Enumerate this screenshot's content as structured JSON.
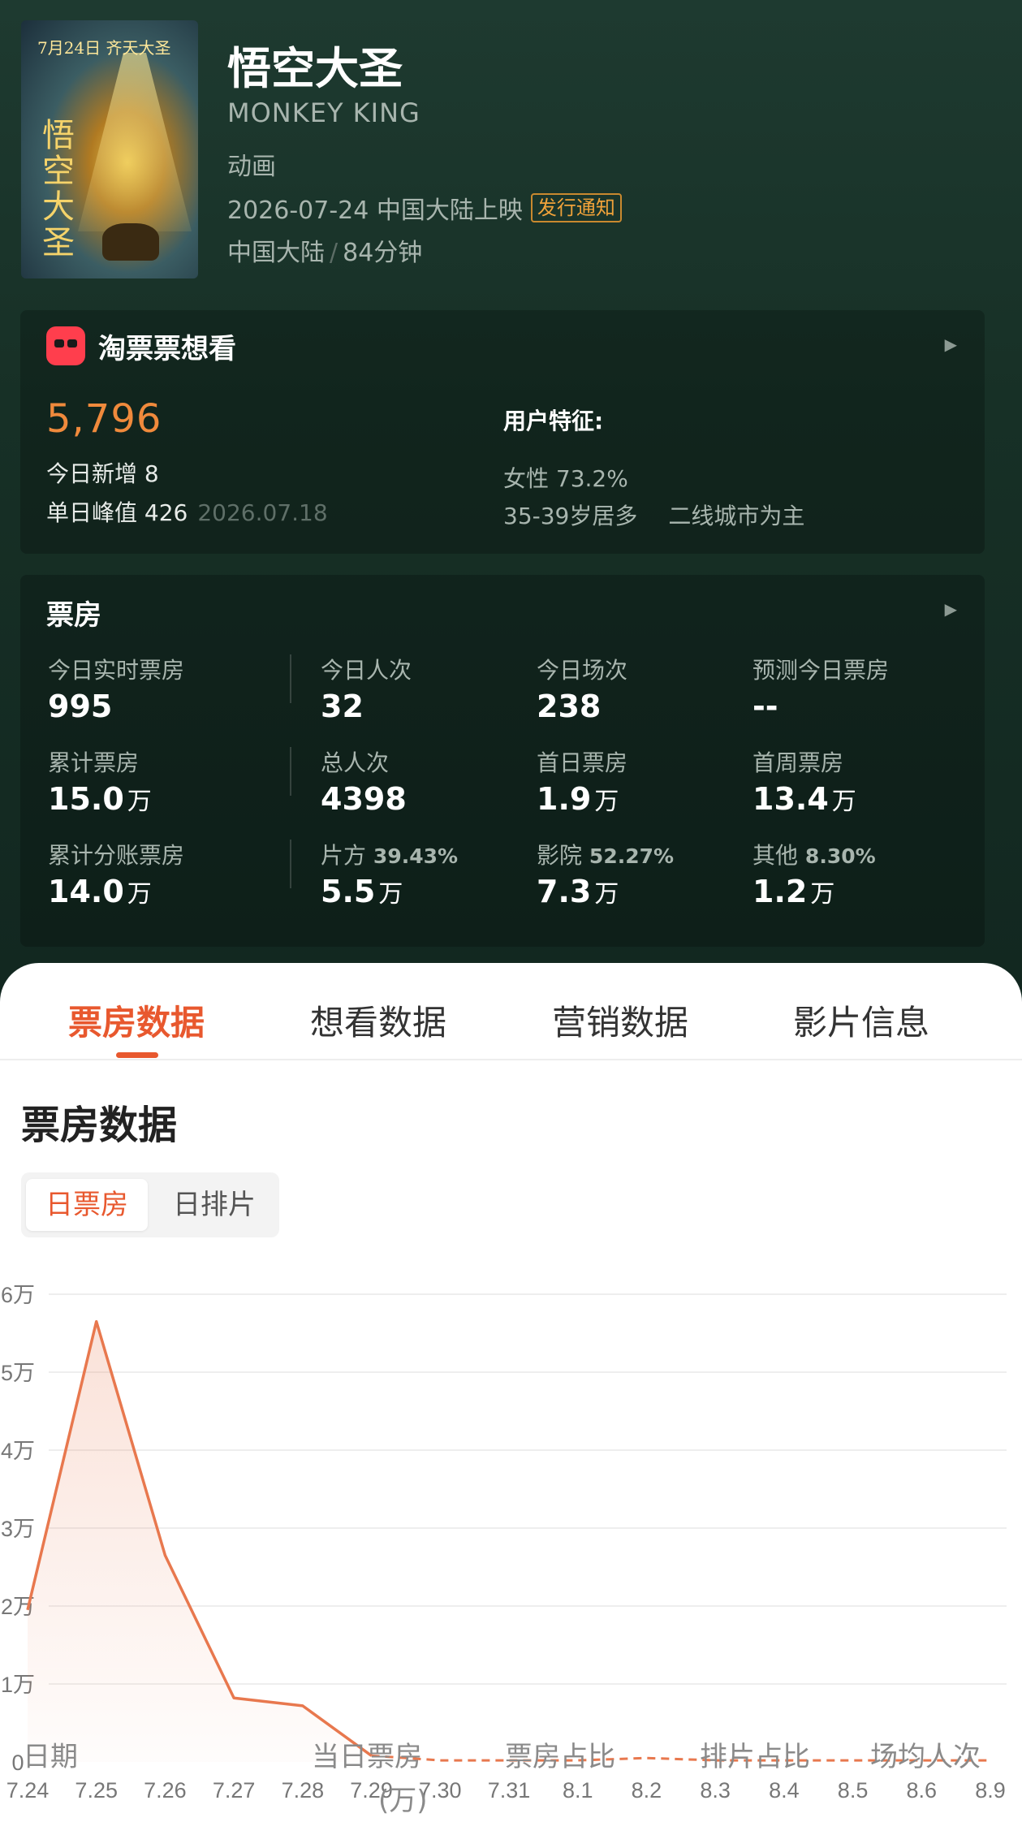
{
  "film": {
    "poster_text": "7月24日 齐天大圣",
    "poster_title": "悟空大圣",
    "title": "悟空大圣",
    "english_title": "MONKEY KING",
    "genre": "动画",
    "release": "2026-07-24 中国大陆上映",
    "release_badge": "发行通知",
    "region": "中国大陆",
    "duration": "84分钟"
  },
  "want": {
    "title": "淘票票想看",
    "count": "5,796",
    "today_new": "今日新增 8",
    "peak": "单日峰值 426",
    "peak_date": "2026.07.18",
    "user_title": "用户特征:",
    "female": "女性 73.2%",
    "age": "35-39岁居多",
    "city": "二线城市为主",
    "arrow": "▶"
  },
  "box": {
    "title": "票房",
    "arrow": "▶",
    "cells": [
      {
        "label": "今日实时票房",
        "value": "995",
        "unit": ""
      },
      {
        "label": "今日人次",
        "value": "32",
        "unit": ""
      },
      {
        "label": "今日场次",
        "value": "238",
        "unit": ""
      },
      {
        "label": "预测今日票房",
        "value": "--",
        "unit": ""
      },
      {
        "label": "累计票房",
        "value": "15.0",
        "unit": "万"
      },
      {
        "label": "总人次",
        "value": "4398",
        "unit": ""
      },
      {
        "label": "首日票房",
        "value": "1.9",
        "unit": "万"
      },
      {
        "label": "首周票房",
        "value": "13.4",
        "unit": "万"
      },
      {
        "label": "累计分账票房",
        "value": "14.0",
        "unit": "万"
      },
      {
        "label": "片方",
        "pct": "39.43%",
        "value": "5.5",
        "unit": "万"
      },
      {
        "label": "影院",
        "pct": "52.27%",
        "value": "7.3",
        "unit": "万"
      },
      {
        "label": "其他",
        "pct": "8.30%",
        "value": "1.2",
        "unit": "万"
      }
    ]
  },
  "tabs": [
    "票房数据",
    "想看数据",
    "营销数据",
    "影片信息"
  ],
  "section_title": "票房数据",
  "segment": {
    "active": "日票房",
    "inactive": "日排片"
  },
  "table_headers": [
    "日期",
    "当日票房",
    "(万)",
    "票房占比",
    "排片占比",
    "场均人次"
  ],
  "chart_data": {
    "type": "line",
    "categories": [
      "7.24",
      "7.25",
      "7.26",
      "7.27",
      "7.28",
      "7.29",
      "7.30",
      "7.31",
      "8.1",
      "8.2",
      "8.3",
      "8.4",
      "8.5",
      "8.6",
      "8.9"
    ],
    "series": [
      {
        "values": [
          1.95,
          5.65,
          2.65,
          0.82,
          0.72,
          0.08,
          0.02,
          0.02,
          0.02,
          0.05,
          0.02,
          0.02,
          0.02,
          0.02,
          0.02
        ]
      }
    ],
    "ytick_labels": [
      "0",
      "1万",
      "2万",
      "3万",
      "4万",
      "5万",
      "6万"
    ],
    "ylim": [
      0,
      6
    ],
    "solid_until_index": 5,
    "line_color": "#e8784e",
    "grid": true
  }
}
